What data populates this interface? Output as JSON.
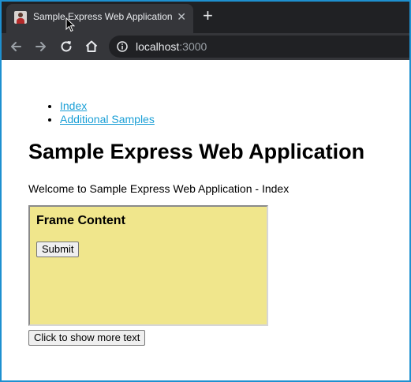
{
  "browser": {
    "tab_title": "Sample Express Web Application",
    "tab_close": "✕",
    "new_tab": "+",
    "url_host": "localhost",
    "url_port": ":3000"
  },
  "page": {
    "nav_links": [
      {
        "label": "Index"
      },
      {
        "label": "Additional Samples"
      }
    ],
    "heading": "Sample Express Web Application",
    "welcome": "Welcome to Sample Express Web Application - Index",
    "frame": {
      "title": "Frame Content",
      "submit_label": "Submit",
      "background": "#f0e68c"
    },
    "more_button_label": "Click to show more text"
  },
  "colors": {
    "link": "#1a9fd6",
    "tabbar": "#202124",
    "toolbar": "#35363a",
    "window_border": "#1e90d0"
  }
}
